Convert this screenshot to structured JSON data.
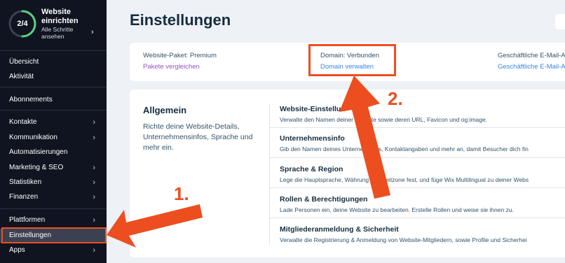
{
  "setup": {
    "progress": "2/4",
    "progress_fraction": 0.5,
    "title": "Website einrichten",
    "subtitle": "Alle Schritte ansehen"
  },
  "sidebar": {
    "items": [
      {
        "label": "Übersicht"
      },
      {
        "label": "Aktivität"
      },
      {
        "label": "Abonnements"
      },
      {
        "label": "Kontakte"
      },
      {
        "label": "Kommunikation"
      },
      {
        "label": "Automatisierungen"
      },
      {
        "label": "Marketing & SEO"
      },
      {
        "label": "Statistiken"
      },
      {
        "label": "Finanzen"
      },
      {
        "label": "Plattformen"
      },
      {
        "label": "Einstellungen"
      },
      {
        "label": "Apps"
      }
    ]
  },
  "page": {
    "title": "Einstellungen"
  },
  "top_card": {
    "plan_label": "Website-Paket: Premium",
    "plan_link": "Pakete vergleichen",
    "domain_label": "Domain: Verbunden",
    "domain_link": "Domain verwalten",
    "email_label": "Geschäftliche E-Mail-A",
    "email_link": "Geschäftliche E-Mail-A"
  },
  "general": {
    "title": "Allgemein",
    "description": "Richte deine Website-Details, Unternehmensinfos, Sprache und mehr ein."
  },
  "settings_rows": [
    {
      "title": "Website-Einstellun",
      "desc": "Verwalte den Namen deiner Website sowie deren URL, Favicon und og:image."
    },
    {
      "title": "Unternehmensinfo",
      "desc": "Gib den Namen deines Unternehmens, Kontaktangaben und mehr an, damit Besucher dich fin"
    },
    {
      "title": "Sprache & Region",
      "desc": "Lege die Hauptsprache, Währung und Zeitzone fest, und füge Wix Multilingual zu deiner Webs"
    },
    {
      "title": "Rollen & Berechtigungen",
      "desc": "Lade Personen ein, deine Website zu bearbeiten. Erstelle Rollen und weise sie ihnen zu."
    },
    {
      "title": "Mitgliederanmeldung & Sicherheit",
      "desc": "Verwalte die Registrierung & Anmeldung von Website-Mitgliedern, sowie Profile und Sicherhei"
    }
  ],
  "annotations": {
    "step1": "1.",
    "step2": "2."
  },
  "colors": {
    "sidebar_bg": "#0f1420",
    "accent_annotation": "#ec4e20",
    "link_blue": "#3b83e8",
    "link_purple": "#9a4fc9",
    "progress_green": "#5bd07f"
  }
}
